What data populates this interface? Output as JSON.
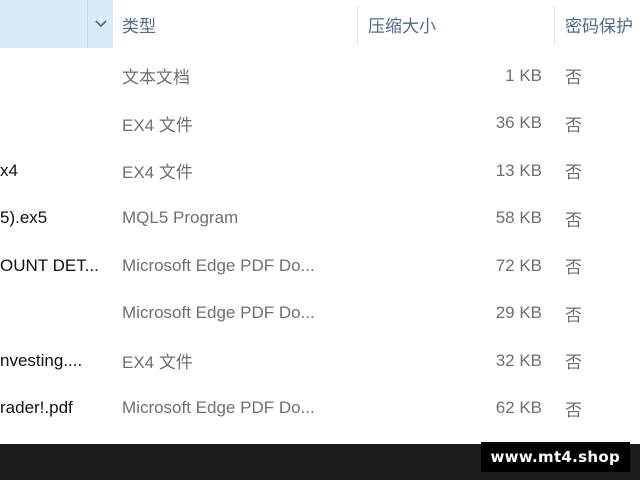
{
  "columns": {
    "type": "类型",
    "size": "压缩大小",
    "password": "密码保护"
  },
  "rows": [
    {
      "name": "",
      "type": "文本文档",
      "size": "1 KB",
      "password": "否"
    },
    {
      "name": "",
      "type": "EX4 文件",
      "size": "36 KB",
      "password": "否"
    },
    {
      "name": "x4",
      "type": "EX4 文件",
      "size": "13 KB",
      "password": "否"
    },
    {
      "name": "5).ex5",
      "type": "MQL5 Program",
      "size": "58 KB",
      "password": "否"
    },
    {
      "name": "OUNT DET...",
      "type": "Microsoft Edge PDF Do...",
      "size": "72 KB",
      "password": "否"
    },
    {
      "name": "",
      "type": "Microsoft Edge PDF Do...",
      "size": "29 KB",
      "password": "否"
    },
    {
      "name": "nvesting....",
      "type": "EX4 文件",
      "size": "32 KB",
      "password": "否"
    },
    {
      "name": "rader!.pdf",
      "type": "Microsoft Edge PDF Do...",
      "size": "62 KB",
      "password": "否"
    }
  ],
  "watermark": "www.mt4.shop",
  "icons": {
    "sort": "chevron-down-icon"
  },
  "colors": {
    "header_highlight": "#dbeaf8",
    "header_text": "#4d6a8f",
    "footer_bar": "#1c1c1c"
  }
}
